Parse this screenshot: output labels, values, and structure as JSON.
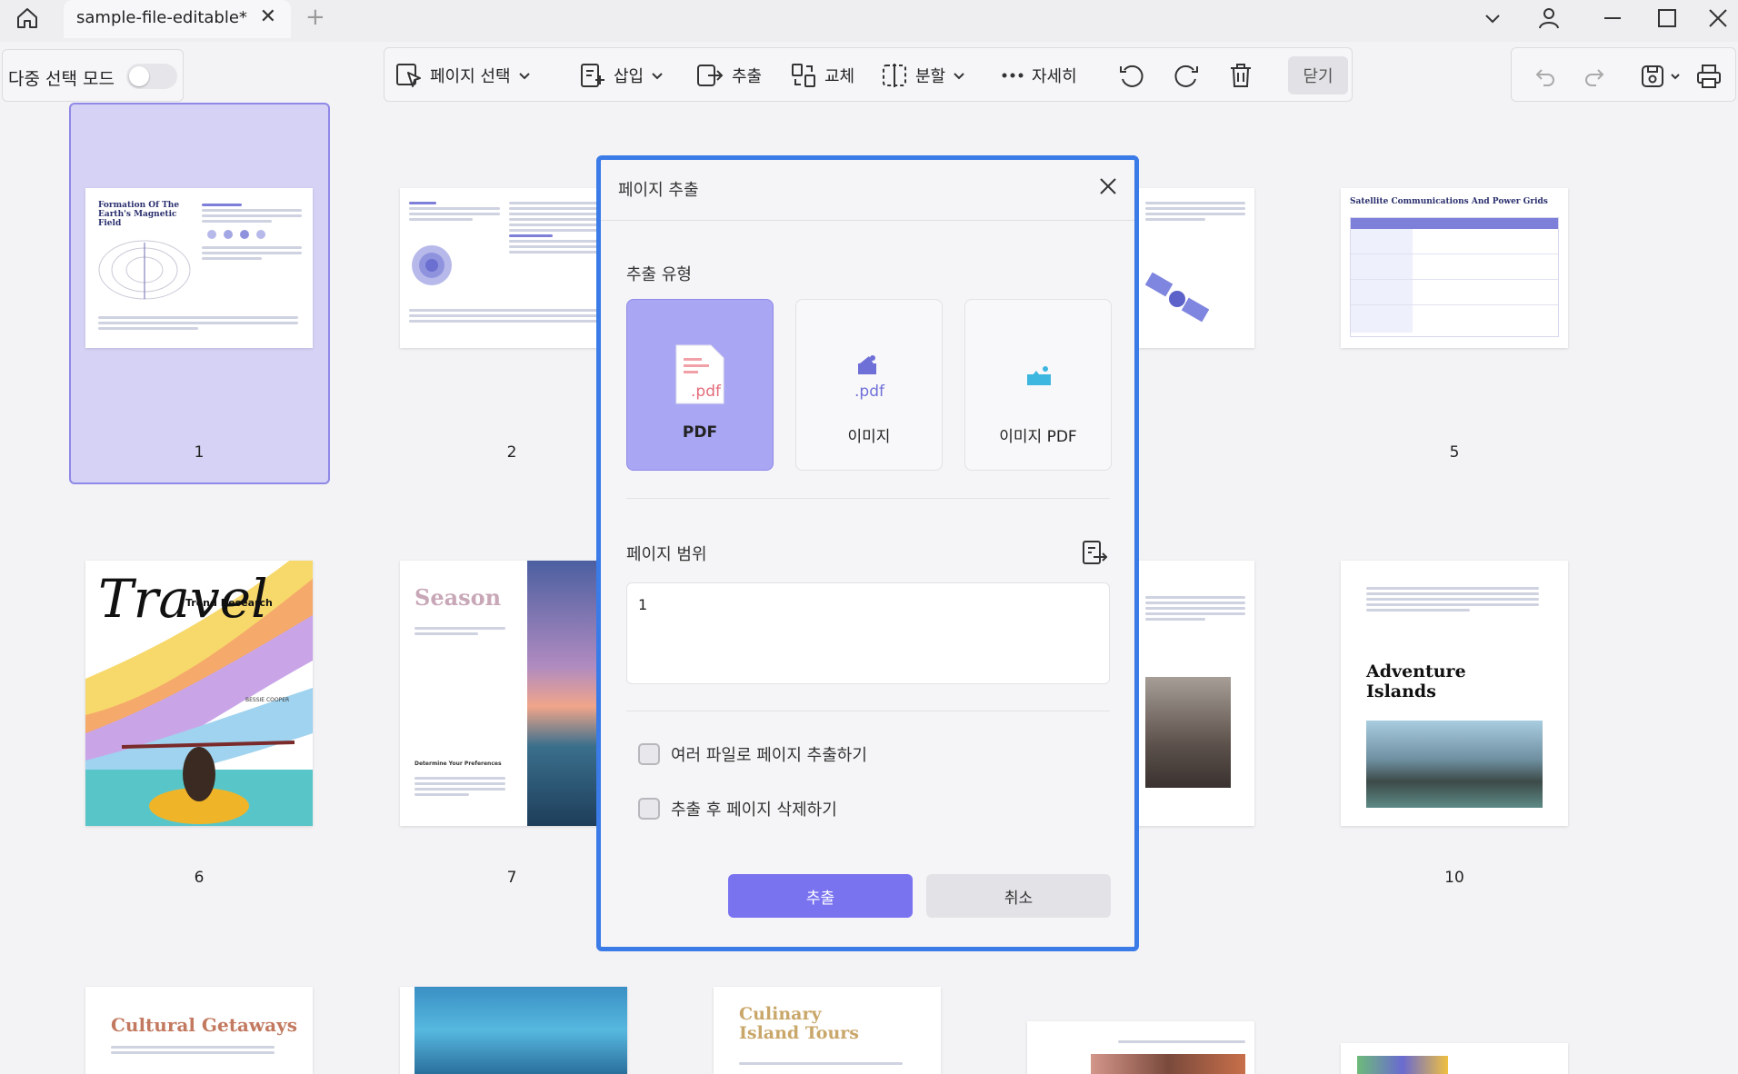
{
  "window": {
    "tab_title": "sample-file-editable*",
    "close_tab_symbol": "✕",
    "new_tab_symbol": "+"
  },
  "toolbar": {
    "multi_select_label": "다중 선택 모드",
    "multi_select_on": false,
    "page_select": "페이지 선택",
    "insert": "삽입",
    "extract": "추출",
    "replace": "교체",
    "split": "분할",
    "more": "자세히",
    "close": "닫기"
  },
  "pages": [
    {
      "num": "1",
      "title": "Formation Of The Earth's Magnetic Field"
    },
    {
      "num": "2"
    },
    {
      "num": "5",
      "title": "Satellite Communications And Power Grids"
    },
    {
      "num": "6",
      "title": "Travel",
      "subtitle": "Trend Research",
      "author": "BESSIE COOPER"
    },
    {
      "num": "7",
      "title": "Season",
      "subtitle": "Determine Your Preferences"
    },
    {
      "num": "10",
      "title": "Adventure Islands"
    },
    {
      "title": "Cultural Getaways"
    },
    {
      "title": "Culinary Island Tours"
    }
  ],
  "dialog": {
    "title": "페이지 추출",
    "type_label": "추출 유형",
    "types": [
      {
        "label": "PDF",
        "icon": "pdf-file-icon",
        "selected": true
      },
      {
        "label": "이미지",
        "icon": "image-file-icon",
        "selected": false
      },
      {
        "label": "이미지 PDF",
        "icon": "image-pdf-icon",
        "selected": false
      }
    ],
    "pdf_ext": ".pdf",
    "range_label": "페이지 범위",
    "range_value": "1",
    "option_multi_files": "여러 파일로 페이지 추출하기",
    "option_delete_after": "추출 후 페이지 삭제하기",
    "extract_button": "추출",
    "cancel_button": "취소"
  },
  "colors": {
    "accent": "#7a73f0",
    "selected_card": "#a9a6f3",
    "modal_border": "#3a7be8",
    "selection_frame": "#d5d2f5"
  }
}
